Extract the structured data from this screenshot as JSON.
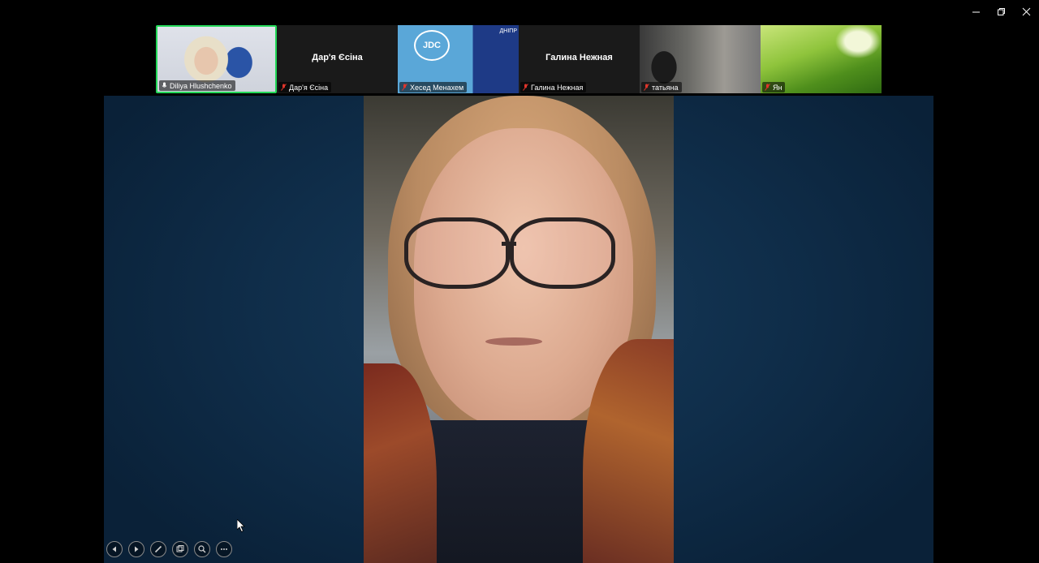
{
  "window_controls": {
    "minimize_icon": "minimize-icon",
    "restore_icon": "restore-icon",
    "close_icon": "close-icon"
  },
  "participants": [
    {
      "name": "Diliya Hlushchenko",
      "display": "video",
      "active_speaker": true,
      "muted": false
    },
    {
      "name": "Дар'я Єсіна",
      "display": "name",
      "center_name": "Дар'я Єсіна",
      "muted": true
    },
    {
      "name": "Хесед Менахем",
      "display": "video",
      "muted": true,
      "logo_text": "JDC",
      "side_text": "ДНІПР"
    },
    {
      "name": "Галина Нежная",
      "display": "name",
      "center_name": "Галина Нежная",
      "muted": true
    },
    {
      "name": "татьяна",
      "display": "video",
      "muted": true
    },
    {
      "name": "Ян",
      "display": "video",
      "muted": true
    }
  ],
  "colors": {
    "active_speaker_border": "#23d959",
    "muted_mic": "#e0352b",
    "stage_background": "#0f2d49"
  },
  "presentation_controls": [
    {
      "name": "previous-slide-button",
      "icon": "chevron-left-icon"
    },
    {
      "name": "next-slide-button",
      "icon": "chevron-right-icon"
    },
    {
      "name": "pen-button",
      "icon": "pen-icon"
    },
    {
      "name": "slides-button",
      "icon": "slides-icon"
    },
    {
      "name": "zoom-button",
      "icon": "magnifier-icon"
    },
    {
      "name": "more-button",
      "icon": "ellipsis-icon"
    }
  ]
}
